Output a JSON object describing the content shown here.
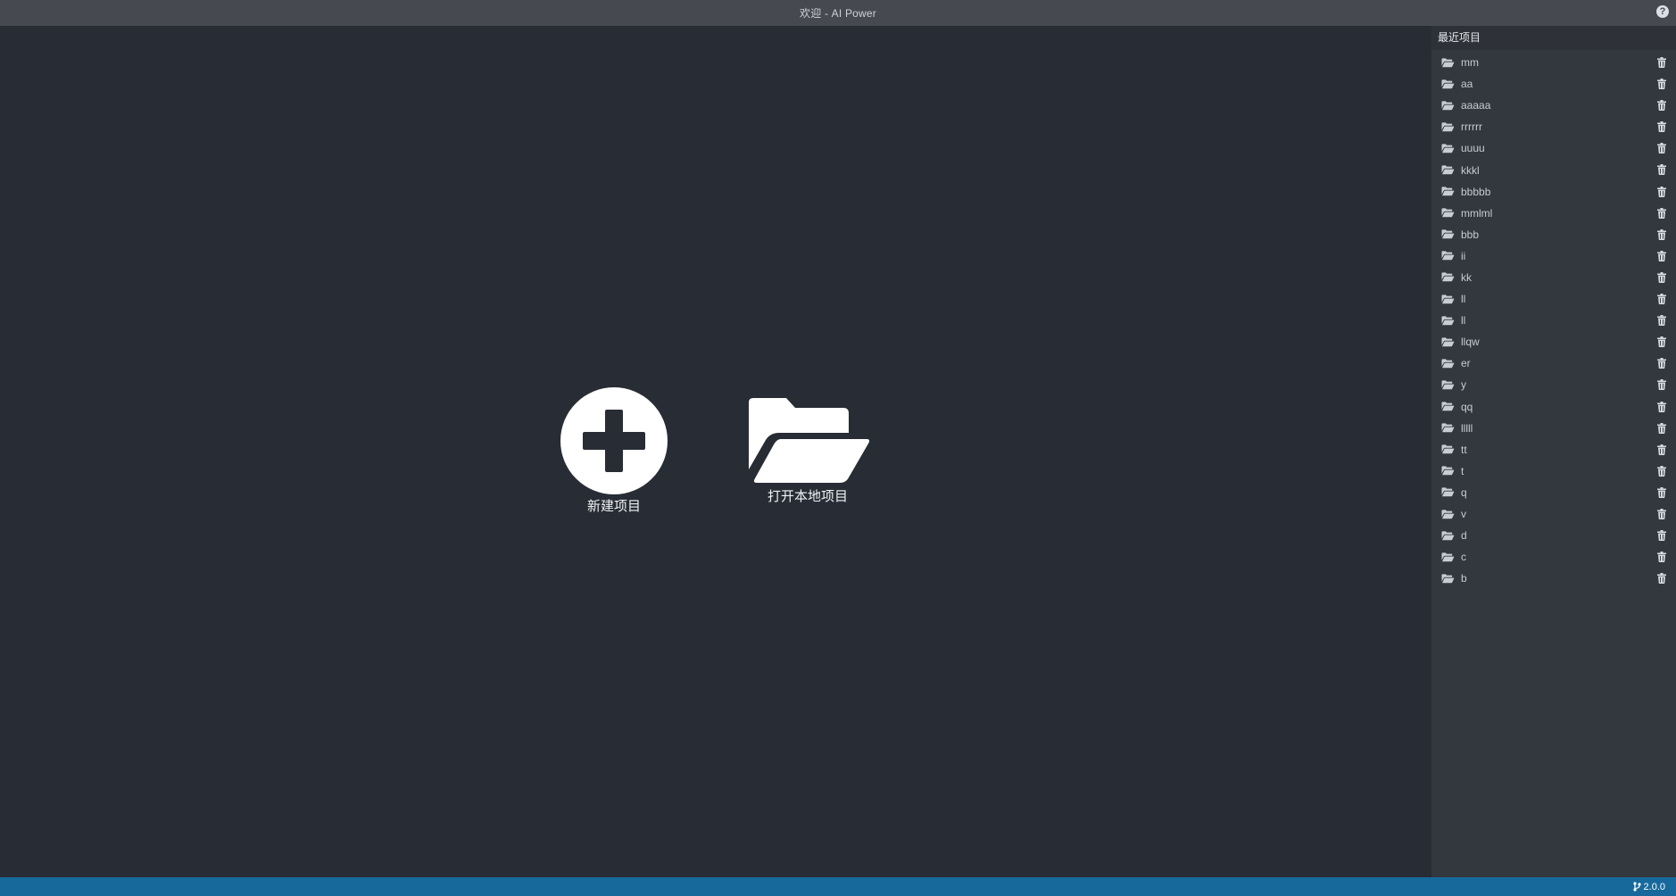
{
  "window": {
    "title": "欢迎 - AI Power",
    "help_icon": "question-circle-icon"
  },
  "actions": {
    "new_project": {
      "label": "新建项目",
      "icon": "plus-circle-icon"
    },
    "open_local_project": {
      "label": "打开本地项目",
      "icon": "folder-open-icon"
    }
  },
  "recent": {
    "title": "最近项目",
    "items": [
      {
        "name": "mm"
      },
      {
        "name": "aa"
      },
      {
        "name": "aaaaa"
      },
      {
        "name": "rrrrrr"
      },
      {
        "name": "uuuu"
      },
      {
        "name": "kkkl"
      },
      {
        "name": "bbbbb"
      },
      {
        "name": "mmlml"
      },
      {
        "name": "bbb"
      },
      {
        "name": "ii"
      },
      {
        "name": "kk"
      },
      {
        "name": "ll"
      },
      {
        "name": "ll"
      },
      {
        "name": "llqw"
      },
      {
        "name": "er"
      },
      {
        "name": "y"
      },
      {
        "name": "qq"
      },
      {
        "name": "lllll"
      },
      {
        "name": "tt"
      },
      {
        "name": "t"
      },
      {
        "name": "q"
      },
      {
        "name": "v"
      },
      {
        "name": "d"
      },
      {
        "name": "c"
      },
      {
        "name": "b"
      }
    ]
  },
  "statusbar": {
    "version": "2.0.0",
    "icon": "git-branch-icon"
  },
  "colors": {
    "background": "#282c34",
    "titlebar": "#46494f",
    "sidebar": "#33373e",
    "statusbar": "#17699c",
    "icon_fill": "#ffffff"
  }
}
